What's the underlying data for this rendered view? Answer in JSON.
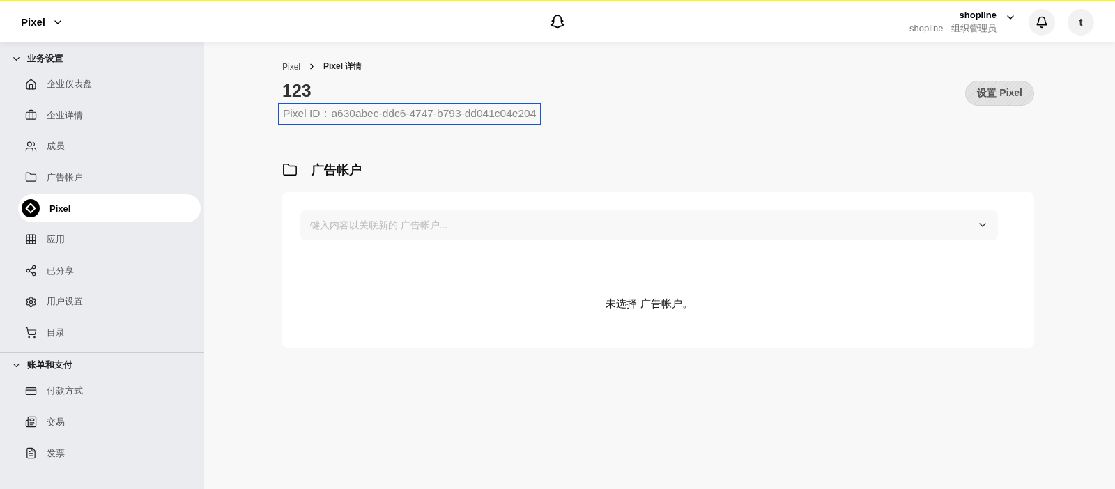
{
  "header": {
    "app_title": "Pixel",
    "account_name": "shopline",
    "account_role": "shopline - 组织管理员",
    "avatar_letter": "t"
  },
  "sidebar": {
    "groups": [
      {
        "title": "业务设置",
        "expanded": true,
        "items": [
          {
            "label": "企业仪表盘",
            "selected": false
          },
          {
            "label": "企业详情",
            "selected": false
          },
          {
            "label": "成员",
            "selected": false
          },
          {
            "label": "广告帐户",
            "selected": false
          },
          {
            "label": "Pixel",
            "selected": true
          },
          {
            "label": "应用",
            "selected": false
          },
          {
            "label": "已分享",
            "selected": false
          },
          {
            "label": "用户设置",
            "selected": false
          },
          {
            "label": "目录",
            "selected": false
          }
        ]
      },
      {
        "title": "账单和支付",
        "expanded": true,
        "items": [
          {
            "label": "付款方式",
            "selected": false
          },
          {
            "label": "交易",
            "selected": false
          },
          {
            "label": "发票",
            "selected": false
          }
        ]
      }
    ]
  },
  "breadcrumb": [
    {
      "label": "Pixel",
      "current": false
    },
    {
      "label": "Pixel 详情",
      "current": true
    }
  ],
  "title": "123",
  "pixel_id": {
    "text": "Pixel ID：a630abec-ddc6-4747-b793-dd041c04e204",
    "highlighted": true
  },
  "setup_button": {
    "label": "设置 Pixel",
    "disabled": true
  },
  "section": {
    "title": "广告帐户",
    "search": {
      "placeholder": "键入内容以关联新的 广告帐户..."
    },
    "empty_message": "未选择 广告帐户。"
  }
}
